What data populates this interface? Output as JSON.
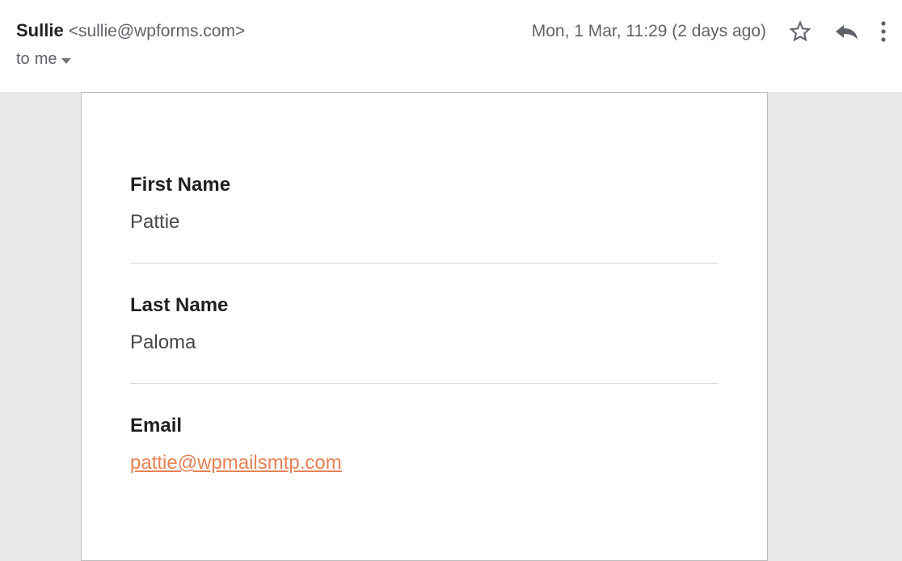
{
  "header": {
    "sender_name": "Sullie",
    "sender_email": "<sullie@wpforms.com>",
    "recipient_prefix": "to",
    "recipient": "me",
    "timestamp": "Mon, 1 Mar, 11:29 (2 days ago)"
  },
  "body": {
    "fields": [
      {
        "label": "First Name",
        "value": "Pattie",
        "is_link": false
      },
      {
        "label": "Last Name",
        "value": "Paloma",
        "is_link": false
      },
      {
        "label": "Email",
        "value": "pattie@wpmailsmtp.com",
        "is_link": true
      }
    ]
  },
  "colors": {
    "link": "#e88255",
    "muted": "#5f6368",
    "body_bg": "#e8e8e8",
    "card_border": "#bdbdbd"
  }
}
